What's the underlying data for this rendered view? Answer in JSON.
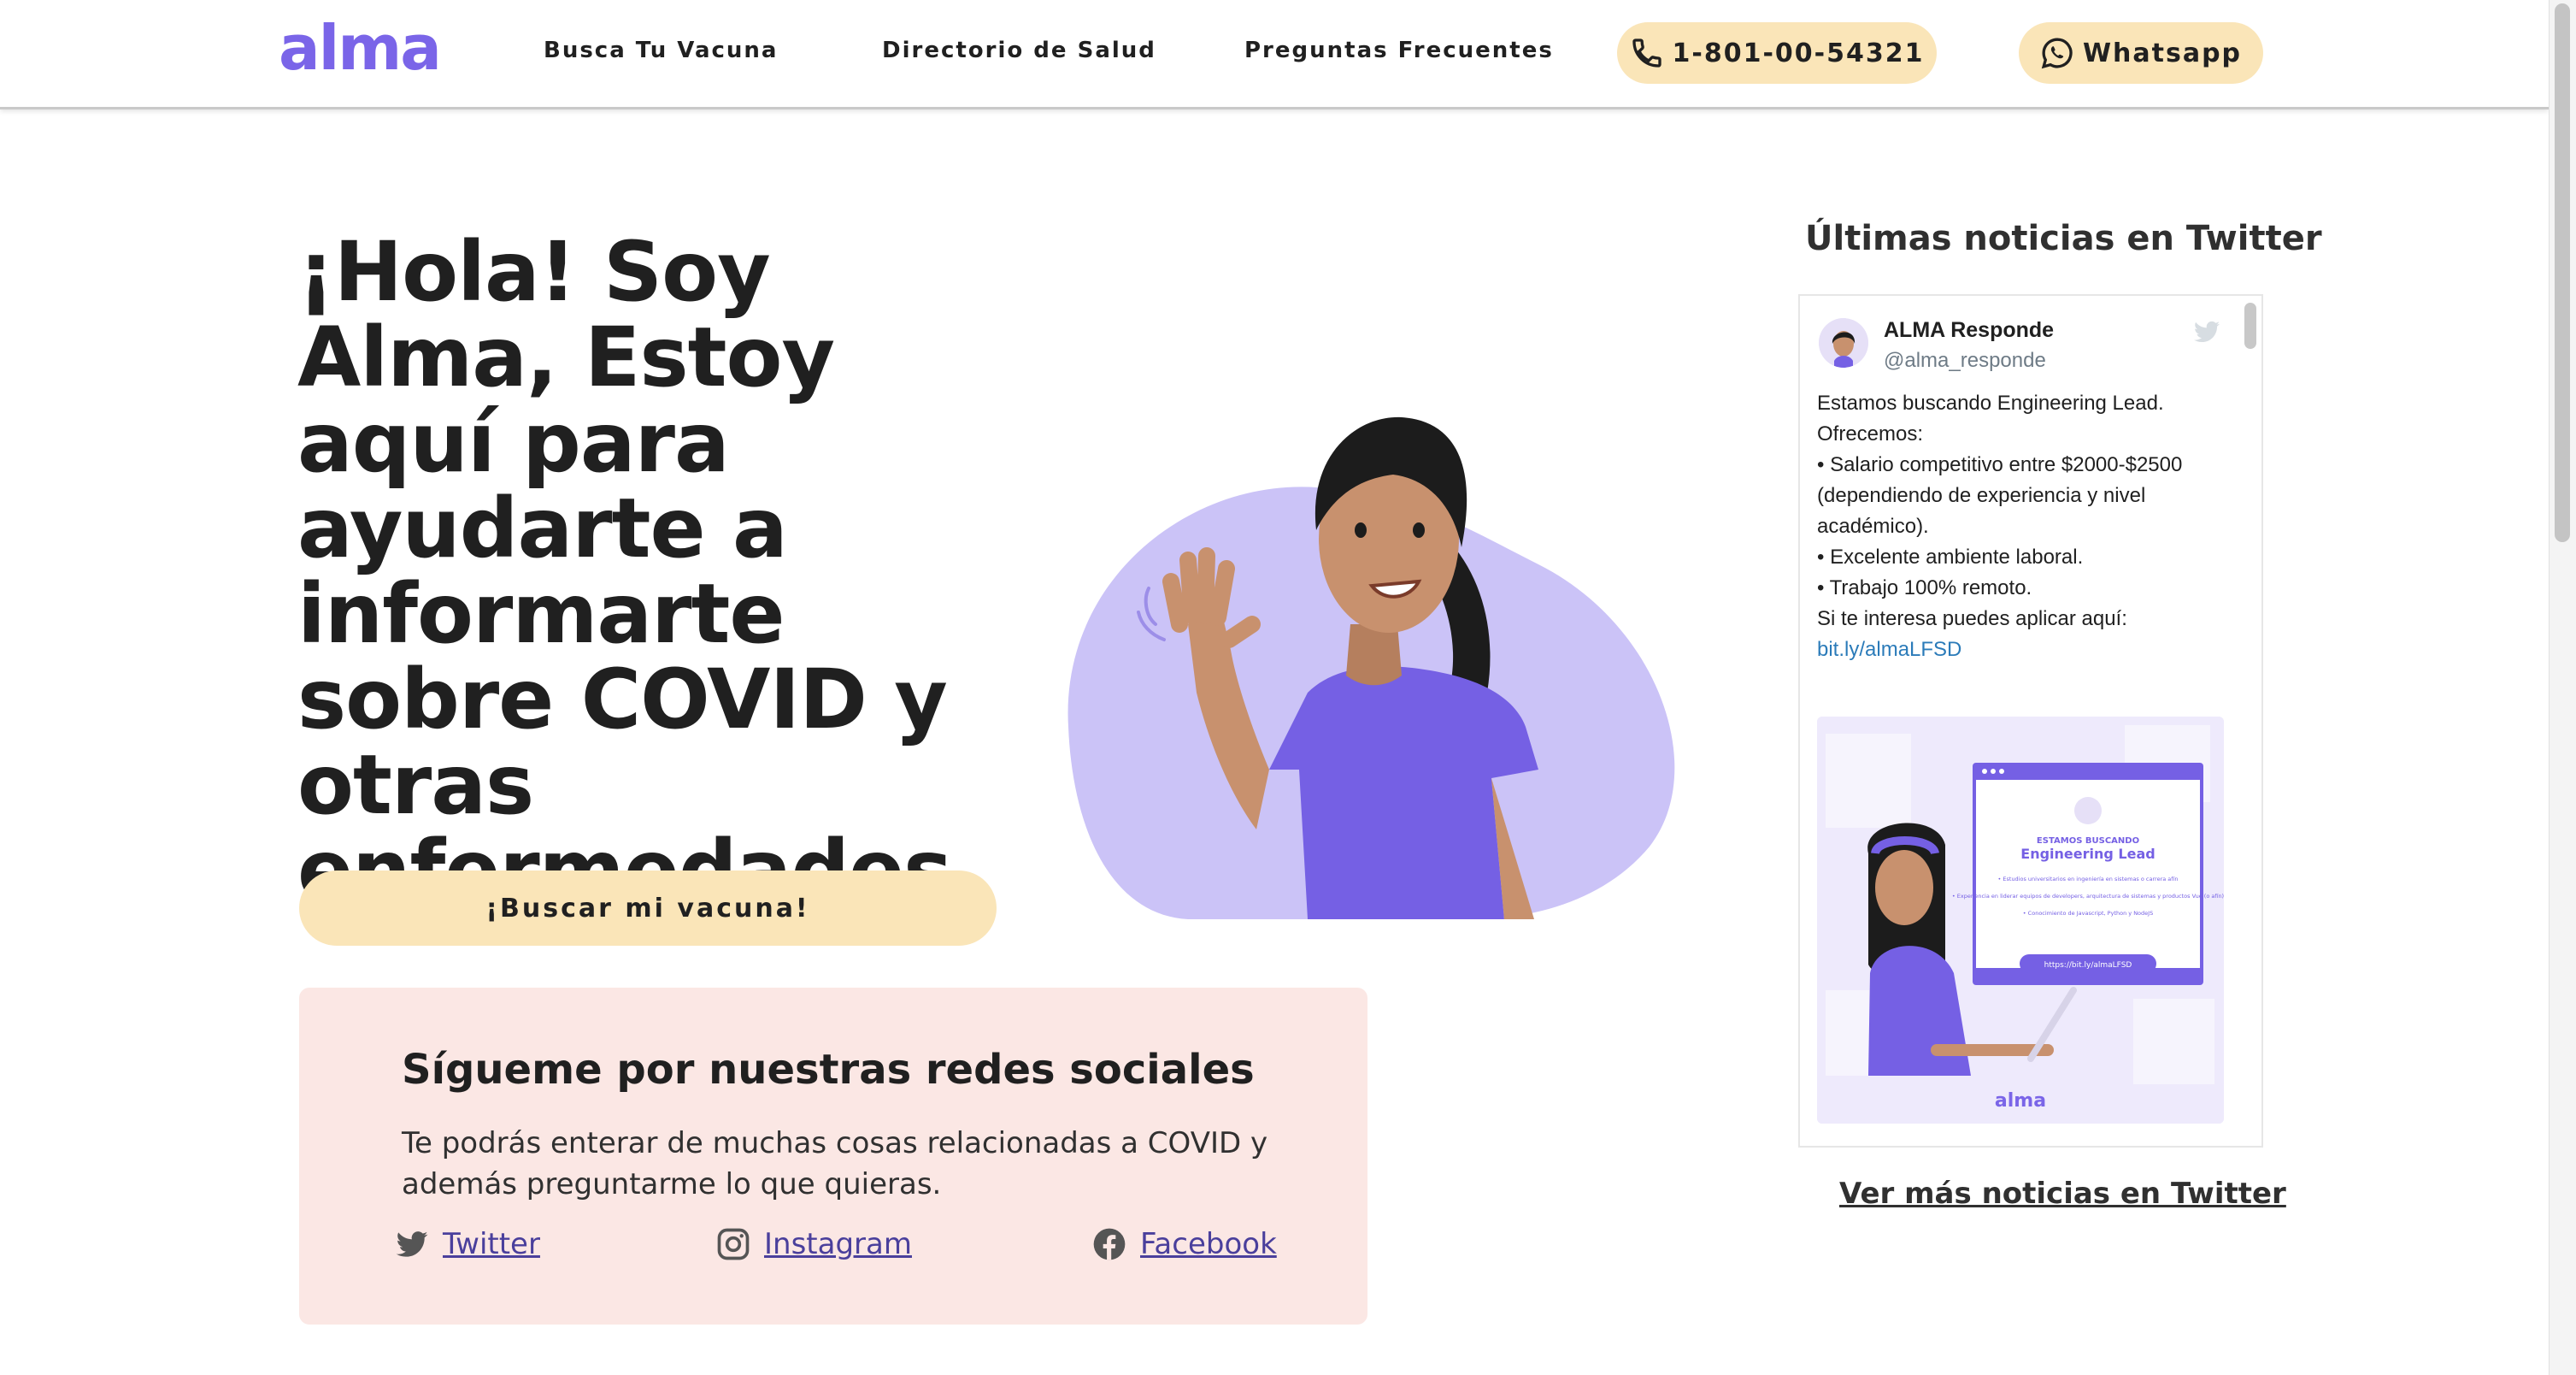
{
  "header": {
    "logo": "alma",
    "nav": [
      {
        "label": "Busca Tu Vacuna"
      },
      {
        "label": "Directorio de Salud"
      },
      {
        "label": "Preguntas Frecuentes"
      }
    ],
    "phone_label": "1-801-00-54321",
    "whatsapp_label": "Whatsapp"
  },
  "hero": {
    "title": "¡Hola! Soy Alma, Estoy aquí para ayudarte a informarte sobre COVID y otras enfermedades",
    "cta_label": "¡Buscar mi vacuna!"
  },
  "social": {
    "title": "Sígueme por nuestras redes sociales",
    "text": "Te podrás enterar de muchas cosas relacionadas a COVID y además preguntarme lo que quieras.",
    "links": [
      {
        "label": "Twitter",
        "icon": "twitter-icon"
      },
      {
        "label": "Instagram",
        "icon": "instagram-icon"
      },
      {
        "label": "Facebook",
        "icon": "facebook-icon"
      }
    ]
  },
  "twitter": {
    "heading": "Últimas noticias en Twitter",
    "more_label": "Ver más noticias en Twitter",
    "tweet": {
      "name": "ALMA Responde",
      "handle": "@alma_responde",
      "lines": [
        "Estamos buscando Engineering Lead.",
        "Ofrecemos:",
        "• Salario competitivo entre $2000-$2500 (dependiendo de experiencia y nivel académico).",
        "• Excelente ambiente laboral.",
        "• Trabajo 100% remoto.",
        "Si te interesa puedes aplicar aquí:"
      ],
      "link": "bit.ly/almaLFSD",
      "media": {
        "kicker": "ESTAMOS BUSCANDO",
        "title": "Engineering Lead",
        "bullets": [
          "• Estudios universitarios en ingeniería en sistemas o carrera afín",
          "• Experiencia en liderar equipos de developers, arquitectura de sistemas y productos Vue (o afín)",
          "• Conocimiento de Javascript, Python y NodeJS"
        ],
        "url_label": "https://bit.ly/almaLFSD",
        "logo": "alma"
      }
    }
  },
  "colors": {
    "brand": "#7a65e8",
    "pill": "#fae5b8",
    "social_card": "#fbe7e4",
    "link": "#4a3f9c"
  }
}
